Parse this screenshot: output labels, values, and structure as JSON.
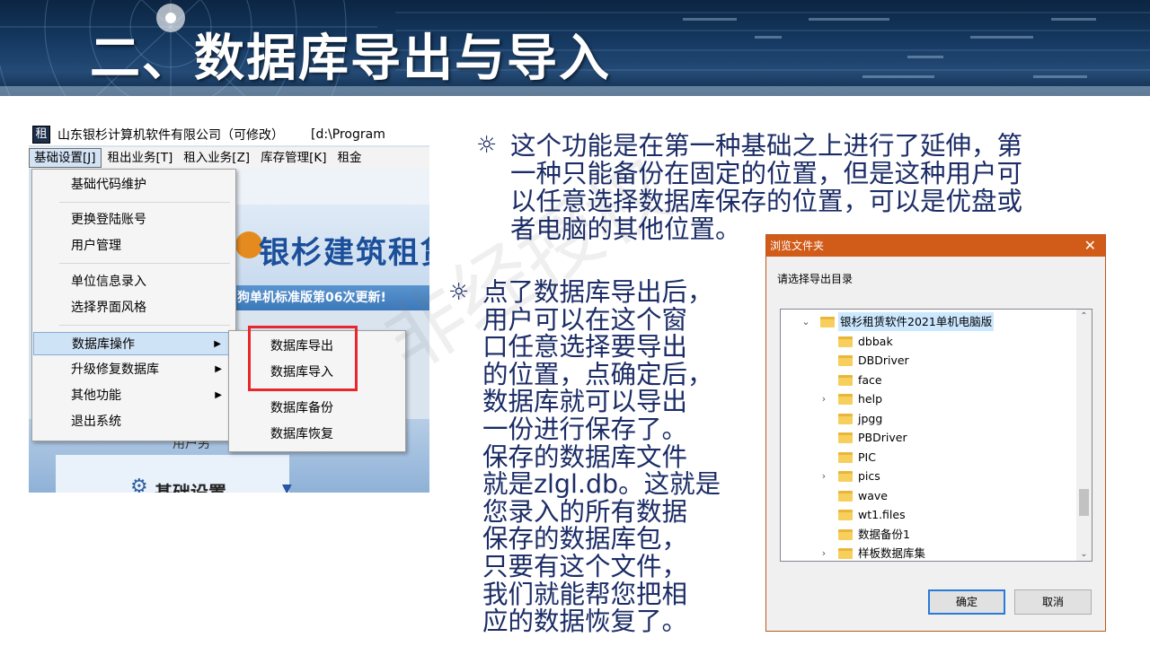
{
  "slide": {
    "title": "二、数据库导出与导入",
    "bullet_symbol": "☼",
    "bullet1_lines": [
      "这个功能是在第一种基础之上进行了延伸，第",
      "一种只能备份在固定的位置，但是这种用户可",
      "以任意选择数据库保存的位置，可以是优盘或",
      "者电脑的其他位置。"
    ],
    "bullet2_lines": [
      "点了数据库导出后，",
      "用户可以在这个窗",
      "口任意选择要导出",
      "的位置，点确定后，",
      "数据库就可以导出",
      "一份进行保存了。",
      "保存的数据库文件",
      "就是zlgl.db。这就是",
      "您录入的所有数据",
      "保存的数据库包，",
      "只要有这个文件，",
      "我们就能帮您把相",
      "应的数据恢复了。"
    ],
    "watermark": "非经授权"
  },
  "app": {
    "icon_char": "租",
    "title": "山东银杉计算机软件有限公司（可修改）",
    "path": "[d:\\Program",
    "menubar": [
      "基础设置[J]",
      "租出业务[T]",
      "租入业务[Z]",
      "库存管理[K]",
      "租金"
    ],
    "banner_text": "银杉建筑租赁",
    "strip_text": "狗单机标准版第06次更新!",
    "partial_label": "用户另",
    "lower_text": "基础设置",
    "gear_icon": "⚙",
    "caret": "▼",
    "dropdown": [
      {
        "label": "基础代码维护"
      },
      {
        "label": "更换登陆账号"
      },
      {
        "label": "用户管理"
      },
      {
        "label": "单位信息录入"
      },
      {
        "label": "选择界面风格"
      },
      {
        "label": "数据库操作",
        "arrow": "▶"
      },
      {
        "label": "升级修复数据库",
        "arrow": "▶"
      },
      {
        "label": "其他功能",
        "arrow": "▶"
      },
      {
        "label": "退出系统"
      }
    ],
    "submenu": [
      {
        "label": "数据库导出"
      },
      {
        "label": "数据库导入"
      },
      {
        "label": "数据库备份"
      },
      {
        "label": "数据库恢复"
      }
    ]
  },
  "dialog": {
    "title": "浏览文件夹",
    "close_glyph": "✕",
    "prompt": "请选择导出目录",
    "tree": [
      {
        "label": "银杉租赁软件2021单机电脑版",
        "expander": "⌄",
        "selected": true,
        "level": 0
      },
      {
        "label": "dbbak",
        "expander": "",
        "level": 1
      },
      {
        "label": "DBDriver",
        "expander": "",
        "level": 1
      },
      {
        "label": "face",
        "expander": "",
        "level": 1
      },
      {
        "label": "help",
        "expander": "›",
        "level": 1
      },
      {
        "label": "jpgg",
        "expander": "",
        "level": 1
      },
      {
        "label": "PBDriver",
        "expander": "",
        "level": 1
      },
      {
        "label": "PIC",
        "expander": "",
        "level": 1
      },
      {
        "label": "pics",
        "expander": "›",
        "level": 1
      },
      {
        "label": "wave",
        "expander": "",
        "level": 1
      },
      {
        "label": "wt1.files",
        "expander": "",
        "level": 1
      },
      {
        "label": "数据备份1",
        "expander": "",
        "level": 1
      },
      {
        "label": "样板数据库集",
        "expander": "›",
        "level": 1
      }
    ],
    "scroll_up": "⌃",
    "scroll_down": "⌄",
    "ok_label": "确定",
    "cancel_label": "取消"
  },
  "colors": {
    "title_text": "#ffffff",
    "bullet_text": "#1b2c66",
    "dialog_titlebar": "#d15b18",
    "highlight_box": "#e8262b",
    "tree_selection": "#cce8ff"
  }
}
